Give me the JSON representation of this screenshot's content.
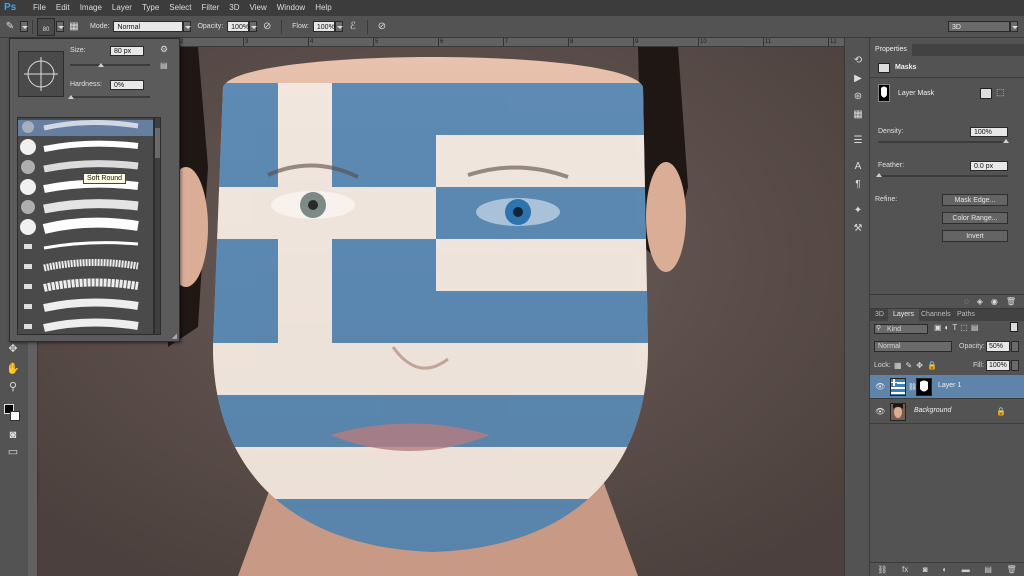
{
  "menubar": {
    "logo": "Ps",
    "items": [
      "File",
      "Edit",
      "Image",
      "Layer",
      "Type",
      "Select",
      "Filter",
      "3D",
      "View",
      "Window",
      "Help"
    ]
  },
  "options": {
    "brush_size": "80",
    "mode_label": "Mode:",
    "mode_value": "Normal",
    "opacity_label": "Opacity:",
    "opacity_value": "100%",
    "flow_label": "Flow:",
    "flow_value": "100%",
    "workspace": "3D"
  },
  "ruler": {
    "ticks": [
      "0",
      "1",
      "2",
      "3",
      "4",
      "5",
      "6",
      "7",
      "8",
      "9",
      "10",
      "11",
      "12"
    ]
  },
  "brush_panel": {
    "size_label": "Size:",
    "size_value": "80 px",
    "hardness_label": "Hardness:",
    "hardness_value": "0%",
    "tooltip": "Soft Round"
  },
  "properties": {
    "tab": "Properties",
    "section": "Masks",
    "mask_type": "Layer Mask",
    "density_label": "Density:",
    "density_value": "100%",
    "feather_label": "Feather:",
    "feather_value": "0.0 px",
    "refine_label": "Refine:",
    "mask_edge_button": "Mask Edge...",
    "color_range_button": "Color Range...",
    "invert_button": "Invert"
  },
  "layers": {
    "tabs": [
      "3D",
      "Layers",
      "Channels",
      "Paths"
    ],
    "kind_label": "Kind",
    "blend_mode": "Normal",
    "opacity_label": "Opacity:",
    "opacity_value": "50%",
    "lock_label": "Lock:",
    "fill_label": "Fill:",
    "fill_value": "100%",
    "items": [
      {
        "name": "Layer 1",
        "selected": true
      },
      {
        "name": "Background",
        "selected": false
      }
    ]
  },
  "colors": {
    "flag_blue": "#3f7fb5",
    "flag_white": "#f3efea",
    "selection": "#5f84aa"
  }
}
